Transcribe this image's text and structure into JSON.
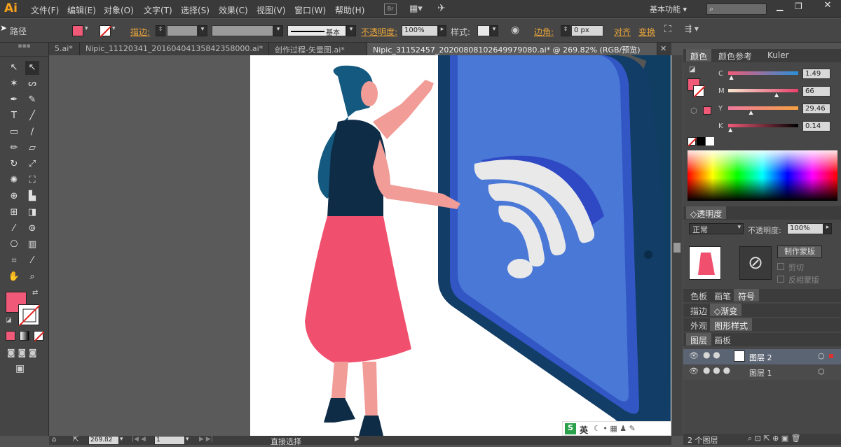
{
  "app": {
    "logo": "Ai",
    "workspace": "基本功能",
    "search_placeholder": ""
  },
  "menu": [
    "文件(F)",
    "编辑(E)",
    "对象(O)",
    "文字(T)",
    "选择(S)",
    "效果(C)",
    "视图(V)",
    "窗口(W)",
    "帮助(H)"
  ],
  "control": {
    "selection_label": "路径",
    "stroke_label": "描边:",
    "brush_label": "基本",
    "opacity_label": "不透明度:",
    "opacity_value": "100%",
    "style_label": "样式:",
    "corner_label": "边角:",
    "corner_value": "0 px",
    "align_label": "对齐",
    "transform_label": "变换",
    "fill_color": "#f05a78"
  },
  "tabs": [
    {
      "label": "5.ai*",
      "active": false
    },
    {
      "label": "Nipic_11120341_20160404135842358000.ai*",
      "active": false
    },
    {
      "label": "创作过程-矢量图.ai*",
      "active": false
    },
    {
      "label": "Nipic_31152457_20200808102649979080.ai* @ 269.82% (RGB/预览)",
      "active": true
    }
  ],
  "color_panel": {
    "tabs": [
      "颜色",
      "颜色参考",
      "Kuler"
    ],
    "channels": [
      {
        "name": "C",
        "value": "1.49",
        "percent": 1.49
      },
      {
        "name": "M",
        "value": "66",
        "percent": 66
      },
      {
        "name": "Y",
        "value": "29.46",
        "percent": 29.46
      },
      {
        "name": "K",
        "value": "0.14",
        "percent": 0.14
      }
    ]
  },
  "transparency_panel": {
    "title": "透明度",
    "blend_mode": "正常",
    "opacity_label": "不透明度:",
    "opacity_value": "100%",
    "make_mask_button": "制作蒙版",
    "clip_label": "剪切",
    "invert_label": "反相蒙版"
  },
  "panel_groups": {
    "group1": [
      "色板",
      "画笔",
      "符号"
    ],
    "group2": [
      "描边",
      "渐变"
    ],
    "group3": [
      "外观",
      "图形样式"
    ],
    "group4": [
      "图层",
      "画板"
    ]
  },
  "layers": [
    {
      "name": "图层 2",
      "selected": true
    },
    {
      "name": "图层 1",
      "selected": false
    }
  ],
  "layers_count": "2 个图层",
  "status": {
    "zoom": "269.82",
    "page": "1",
    "tool": "直接选择"
  },
  "ime": {
    "label": "英"
  }
}
